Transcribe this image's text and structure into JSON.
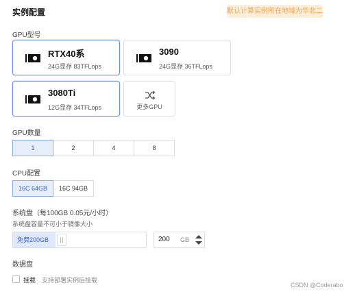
{
  "section_title": "实例配置",
  "region_notice": "默认计算实例所在地域为华北二",
  "gpu_model": {
    "label": "GPU型号",
    "cards": [
      {
        "name": "RTX40系",
        "spec": "24G显存 83TFLops",
        "selected": true
      },
      {
        "name": "3090",
        "spec": "24G显存 36TFLops",
        "selected": false
      },
      {
        "name": "3080Ti",
        "spec": "12G显存 34TFLops",
        "selected": true
      }
    ],
    "more_label": "更多GPU"
  },
  "gpu_count": {
    "label": "GPU数量",
    "options": [
      "1",
      "2",
      "4",
      "8"
    ],
    "selected": "1"
  },
  "cpu_config": {
    "label": "CPU配置",
    "options": [
      "16C 64GB",
      "16C 94GB"
    ],
    "selected": "16C 64GB"
  },
  "system_disk": {
    "label": "系统盘（每100GB 0.05元/小时）",
    "hint": "系统盘容量不可小于镜像大小",
    "free_label": "免费200GB",
    "value": "200",
    "unit": "GB"
  },
  "data_disk": {
    "label": "数据盘",
    "mount_label": "挂载",
    "mount_hint": "支持部署实例后挂载",
    "mounted": false
  },
  "watermark": "CSDN @Coderabo",
  "colors": {
    "accent": "#3a63c8",
    "selected_bg": "#e6eefc",
    "notice_bg": "#fdeed8",
    "notice_text": "#f2a14a"
  },
  "icons": {
    "gpu": "gpu-card-icon",
    "more": "shuffle-icon",
    "stepper_up": "caret-up-icon",
    "stepper_down": "caret-down-icon"
  }
}
